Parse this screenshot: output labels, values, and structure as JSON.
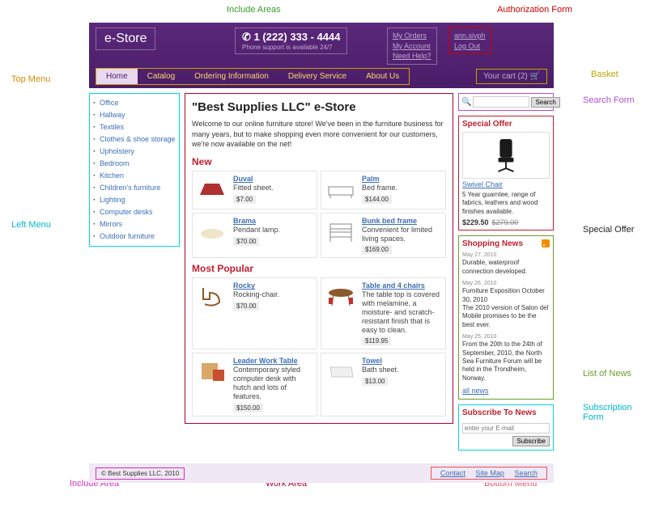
{
  "brand": "e-Store",
  "phone": {
    "number": "1 (222) 333 - 4444",
    "sub": "Phone support is available 24/7"
  },
  "header_links": [
    "My Orders",
    "My Account",
    "Need Help?"
  ],
  "auth": {
    "user": "ann.sivph",
    "logout": "Log Out"
  },
  "top_menu": [
    "Home",
    "Catalog",
    "Ordering Information",
    "Delivery Service",
    "About Us"
  ],
  "basket": {
    "label": "Your cart (2)"
  },
  "left_menu": [
    "Office",
    "Hallway",
    "Textiles",
    "Clothes & shoe storage",
    "Upholstery",
    "Bedroom",
    "Kitchen",
    "Children's furniture",
    "Lighting",
    "Computer desks",
    "Mirrors",
    "Outdoor furniture"
  ],
  "work": {
    "title": "\"Best Supplies LLC\" e-Store",
    "intro": "Welcome to our online furniture store! We've been in the furniture business for many years, but to make shopping even more convenient for our customers, we're now available on the net!",
    "new_h": "New",
    "new_items": [
      {
        "name": "Duval",
        "desc": "Fitted sheet.",
        "price": "$7.00"
      },
      {
        "name": "Palm",
        "desc": "Bed frame.",
        "price": "$144.00"
      },
      {
        "name": "Brama",
        "desc": "Pendant lamp.",
        "price": "$70.00"
      },
      {
        "name": "Bunk bed frame",
        "desc": "Convenient for limited living spaces.",
        "price": "$169.00"
      }
    ],
    "pop_h": "Most Popular",
    "pop_items": [
      {
        "name": "Rocky",
        "desc": "Rocking-chair.",
        "price": "$70.00"
      },
      {
        "name": "Table and 4 chairs",
        "desc": "The table top is covered with melamine, a moisture- and scratch-resistant finish that is easy to clean.",
        "price": "$119.95"
      },
      {
        "name": "Leader Work Table",
        "desc": "Contemporary styled computer desk with hutch and lots of features.",
        "price": "$150.00"
      },
      {
        "name": "Towel",
        "desc": "Bath sheet.",
        "price": "$13.00"
      }
    ]
  },
  "search": {
    "placeholder": "",
    "button": "Search",
    "icon": "🔍"
  },
  "special": {
    "h": "Special Offer",
    "name": "Swivel Chair",
    "desc": "5 Year guarntee, range of fabrics, leathers and wood finishes available.",
    "price": "$229.50",
    "old": "$279.00"
  },
  "news": {
    "h": "Shopping News",
    "items": [
      {
        "date": "May 27, 2010",
        "text": "Durable, waterproof connection developed."
      },
      {
        "date": "May 26, 2010",
        "text": "Furniture Exposition October 30, 2010\nThe 2010 version of Salon del Mobile promises to be the best ever."
      },
      {
        "date": "May 25, 2010",
        "text": "From the 20th to the 24th of September, 2010, the North Sea Furniture Forum will be held in the Trondheim, Norway."
      }
    ],
    "all": "all news"
  },
  "subscribe": {
    "h": "Subscribe To News",
    "placeholder": "enter your E-mail",
    "button": "Subscribe"
  },
  "footer": {
    "copyright": "© Best Supplies LLC, 2010",
    "links": [
      "Contact",
      "Site Map",
      "Search"
    ]
  },
  "annotations": {
    "include_areas": "Include Areas",
    "auth_form": "Authorization Form",
    "top_menu": "Top Menu",
    "basket": "Basket",
    "search_form": "Search Form",
    "left_menu": "Left Menu",
    "special_offer": "Special Offer",
    "list_of_news": "List of News",
    "subscription_form": "Subscription\nForm",
    "include_area": "Include Area",
    "work_area": "Work Area",
    "bottom_menu": "Bottom Menu"
  }
}
